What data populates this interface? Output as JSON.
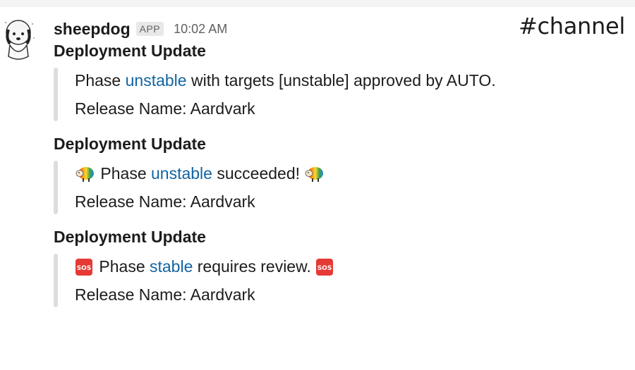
{
  "channel_label": "#channel",
  "sender": {
    "name": "sheepdog",
    "badge": "APP",
    "time": "10:02 AM"
  },
  "messages": [
    {
      "title": "Deployment Update",
      "line1": {
        "prefix": "Phase ",
        "link": "unstable",
        "suffix": " with targets [unstable] approved by AUTO."
      },
      "line2": "Release Name: Aardvark"
    },
    {
      "title": "Deployment Update",
      "line1": {
        "prefix": " Phase ",
        "link": "unstable",
        "suffix": " succeeded! ",
        "emoji": "rainbow-sheep-icon"
      },
      "line2": "Release Name: Aardvark"
    },
    {
      "title": "Deployment Update",
      "line1": {
        "prefix": " Phase ",
        "link": "stable",
        "suffix": " requires review. ",
        "emoji": "sos-icon",
        "emoji_text": "SOS"
      },
      "line2": "Release Name: Aardvark"
    }
  ],
  "colors": {
    "link": "#1264a3",
    "attachment_bar": "#dddddd",
    "sos_red": "#e53935"
  }
}
